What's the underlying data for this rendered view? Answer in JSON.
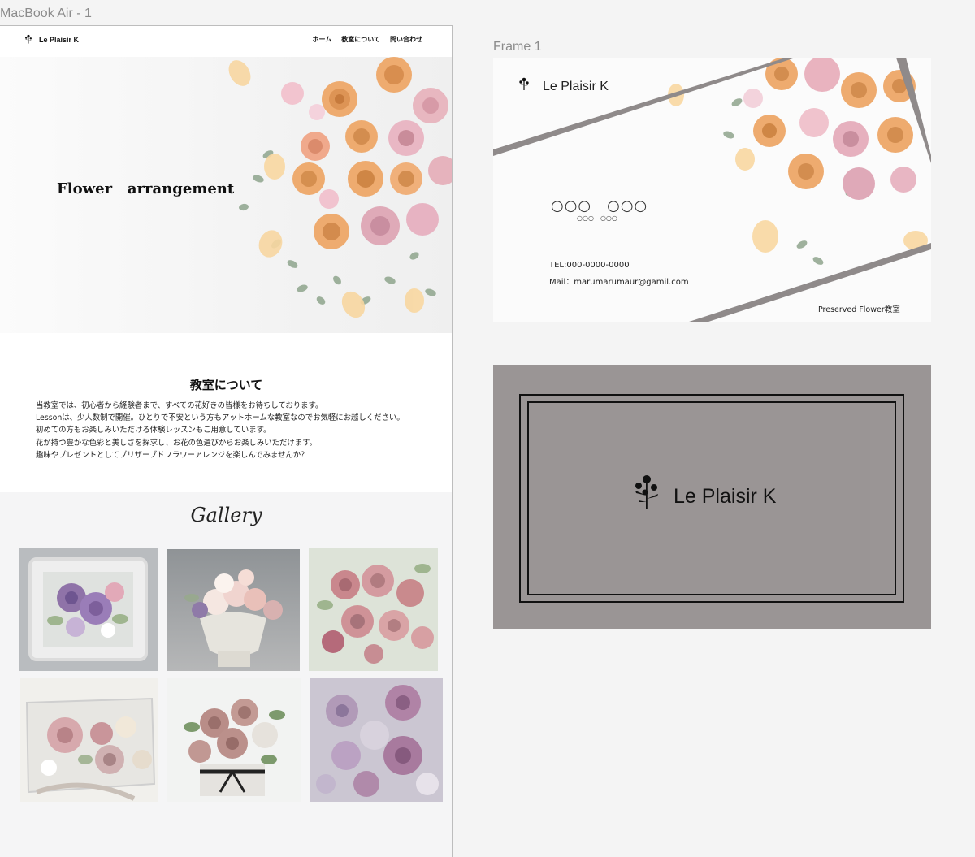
{
  "canvas": {
    "frame_label_site": "MacBook Air - 1",
    "frame_label_card": "Frame 1"
  },
  "site": {
    "brand": "Le Plaisir K",
    "nav": [
      "ホーム",
      "教室について",
      "問い合わせ"
    ],
    "hero_title": "Flower   arrangement",
    "about": {
      "title": "教室について",
      "lines": [
        "当教室では、初心者から経験者まで、すべての花好きの皆様をお待ちしております。",
        "Lessonは、少人数制で開催。ひとりで不安という方もアットホームな教室なのでお気軽にお越しください。",
        "初めての方もお楽しみいただける体験レッスンもご用意しています。",
        "花が持つ豊かな色彩と美しさを探求し、お花の色選びからお楽しみいただけます。",
        "趣味やプレゼントとしてプリザーブドフラワーアレンジを楽しんでみませんか？"
      ]
    },
    "gallery_title": "Gallery"
  },
  "card_front": {
    "brand": "Le Plaisir K",
    "name": "○○○　○○○",
    "name_sub": "○○○　○○○",
    "tel": "TEL:000-0000-0000",
    "mail": "Mail：marumarumaur@gamil.com",
    "tagline": "Preserved Flower教室"
  },
  "card_back": {
    "brand": "Le Plaisir K"
  },
  "colors": {
    "card_gray": "#9a9595",
    "band_gray": "#8f8a8a",
    "peach": "#eeab6f",
    "pink": "#e7b9c3",
    "eucalyptus": "#8fa58d"
  }
}
